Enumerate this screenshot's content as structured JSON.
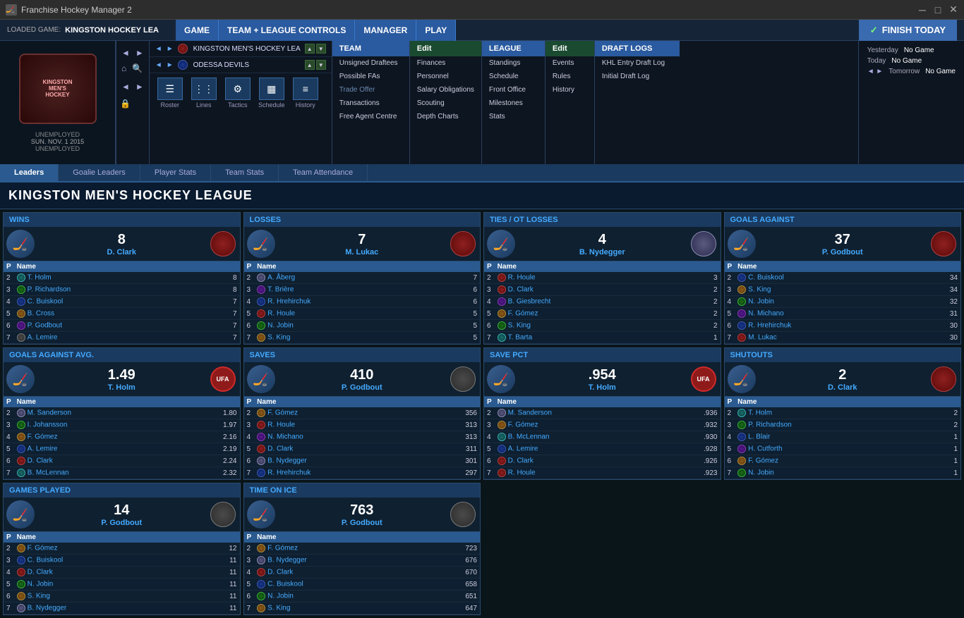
{
  "app": {
    "title": "Franchise Hockey Manager 2",
    "loaded_game_label": "LOADED GAME:",
    "loaded_game": "KINGSTON HOCKEY LEA",
    "status": "UNEMPLOYED",
    "date": "SUN. NOV. 1 2015",
    "status2": "UNEMPLOYED"
  },
  "nav": {
    "game_label": "GAME",
    "team_league_label": "TEAM + LEAGUE CONTROLS",
    "manager_label": "MANAGER",
    "play_label": "PLAY",
    "finish_label": "FINISH TODAY",
    "team_menu": {
      "title": "TEAM",
      "items": [
        "Unsigned Draftees",
        "Possible FAs",
        "Trade Offer",
        "Transactions",
        "Free Agent Centre"
      ]
    },
    "edit_team": {
      "title": "Edit",
      "items": [
        "Finances",
        "Personnel",
        "Salary Obligations",
        "Scouting",
        "Depth Charts"
      ]
    },
    "league_menu": {
      "title": "LEAGUE",
      "items": [
        "Standings",
        "Schedule",
        "Front Office",
        "Milestones",
        "Stats"
      ]
    },
    "edit_league": {
      "title": "Edit",
      "items": [
        "Events",
        "Rules",
        "History"
      ]
    },
    "draft_logs": {
      "title": "DRAFT LOGS",
      "items": [
        "KHL Entry Draft Log",
        "Initial Draft Log"
      ]
    },
    "icons": [
      {
        "label": "Roster",
        "icon": "☰"
      },
      {
        "label": "Lines",
        "icon": "⋮⋮"
      },
      {
        "label": "Tactics",
        "icon": "⚙"
      },
      {
        "label": "Schedule",
        "icon": "▦"
      },
      {
        "label": "History",
        "icon": "≡"
      }
    ],
    "teams": [
      {
        "name": "KINGSTON MEN'S HOCKEY LEA"
      },
      {
        "name": "ODESSA DEVILS"
      }
    ],
    "schedule": {
      "yesterday": "Yesterday",
      "yesterday_val": "No Game",
      "today": "Today",
      "today_val": "No Game",
      "tomorrow": "Tomorrow",
      "tomorrow_val": "No Game"
    }
  },
  "tabs": [
    {
      "id": "leaders",
      "label": "Leaders",
      "active": true
    },
    {
      "id": "goalie-leaders",
      "label": "Goalie Leaders",
      "active": false
    },
    {
      "id": "player-stats",
      "label": "Player Stats",
      "active": false
    },
    {
      "id": "team-stats",
      "label": "Team Stats",
      "active": false
    },
    {
      "id": "team-attendance",
      "label": "Team Attendance",
      "active": false
    }
  ],
  "page_title": "KINGSTON MEN'S HOCKEY LEAGUE",
  "stat_cards": [
    {
      "id": "wins",
      "title": "WINS",
      "leader_value": "8",
      "leader_name": "D. Clark",
      "leader_logo_class": "logo-red",
      "leader_avatar": "🏒",
      "rows": [
        {
          "rank": "2",
          "icon_class": "logo-teal",
          "name": "T. Holm",
          "value": "8"
        },
        {
          "rank": "3",
          "icon_class": "logo-green",
          "name": "P. Richardson",
          "value": "8"
        },
        {
          "rank": "4",
          "icon_class": "logo-blue",
          "name": "C. Buiskool",
          "value": "7"
        },
        {
          "rank": "5",
          "icon_class": "logo-orange",
          "name": "B. Cross",
          "value": "7"
        },
        {
          "rank": "6",
          "icon_class": "logo-purple",
          "name": "P. Godbout",
          "value": "7"
        },
        {
          "rank": "7",
          "icon_class": "logo-gray",
          "name": "A. Lemire",
          "value": "7"
        }
      ]
    },
    {
      "id": "losses",
      "title": "LOSSES",
      "leader_value": "7",
      "leader_name": "M. Lukac",
      "leader_logo_class": "logo-red",
      "leader_avatar": "🏒",
      "rows": [
        {
          "rank": "2",
          "icon_class": "logo-white-star",
          "name": "A. Åberg",
          "value": "7"
        },
        {
          "rank": "3",
          "icon_class": "logo-purple",
          "name": "T. Brière",
          "value": "6"
        },
        {
          "rank": "4",
          "icon_class": "logo-blue",
          "name": "R. Hrehirchuk",
          "value": "6"
        },
        {
          "rank": "5",
          "icon_class": "logo-red",
          "name": "R. Houle",
          "value": "5"
        },
        {
          "rank": "6",
          "icon_class": "logo-green",
          "name": "N. Jobin",
          "value": "5"
        },
        {
          "rank": "7",
          "icon_class": "logo-orange",
          "name": "S. King",
          "value": "5"
        }
      ]
    },
    {
      "id": "ties",
      "title": "TIES / OT LOSSES",
      "leader_value": "4",
      "leader_name": "B. Nydegger",
      "leader_logo_class": "logo-white-star",
      "leader_avatar": "🏒",
      "rows": [
        {
          "rank": "2",
          "icon_class": "logo-red",
          "name": "R. Houle",
          "value": "3"
        },
        {
          "rank": "3",
          "icon_class": "logo-red",
          "name": "D. Clark",
          "value": "2"
        },
        {
          "rank": "4",
          "icon_class": "logo-purple",
          "name": "B. Giesbrecht",
          "value": "2"
        },
        {
          "rank": "5",
          "icon_class": "logo-orange",
          "name": "F. Gómez",
          "value": "2"
        },
        {
          "rank": "6",
          "icon_class": "logo-green",
          "name": "S. King",
          "value": "2"
        },
        {
          "rank": "7",
          "icon_class": "logo-teal",
          "name": "T. Barta",
          "value": "1"
        }
      ]
    },
    {
      "id": "goals-against",
      "title": "GOALS AGAINST",
      "leader_value": "37",
      "leader_name": "P. Godbout",
      "leader_logo_class": "logo-red",
      "leader_avatar": "🏒",
      "rows": [
        {
          "rank": "2",
          "icon_class": "logo-blue",
          "name": "C. Buiskool",
          "value": "34"
        },
        {
          "rank": "3",
          "icon_class": "logo-orange",
          "name": "S. King",
          "value": "34"
        },
        {
          "rank": "4",
          "icon_class": "logo-green",
          "name": "N. Jobin",
          "value": "32"
        },
        {
          "rank": "5",
          "icon_class": "logo-purple",
          "name": "N. Michano",
          "value": "31"
        },
        {
          "rank": "6",
          "icon_class": "logo-blue",
          "name": "R. Hrehirchuk",
          "value": "30"
        },
        {
          "rank": "7",
          "icon_class": "logo-red",
          "name": "M. Lukac",
          "value": "30"
        }
      ]
    },
    {
      "id": "goals-against-avg",
      "title": "GOALS AGAINST AVG.",
      "leader_value": "1.49",
      "leader_name": "T. Holm",
      "leader_logo_class": "logo-ufa",
      "leader_avatar": "🏒",
      "rows": [
        {
          "rank": "2",
          "icon_class": "logo-white-star",
          "name": "M. Sanderson",
          "value": "1.80"
        },
        {
          "rank": "3",
          "icon_class": "logo-green",
          "name": "I. Johansson",
          "value": "1.97"
        },
        {
          "rank": "4",
          "icon_class": "logo-orange",
          "name": "F. Gómez",
          "value": "2.16"
        },
        {
          "rank": "5",
          "icon_class": "logo-blue",
          "name": "A. Lemire",
          "value": "2.19"
        },
        {
          "rank": "6",
          "icon_class": "logo-red",
          "name": "D. Clark",
          "value": "2.24"
        },
        {
          "rank": "7",
          "icon_class": "logo-teal",
          "name": "B. McLennan",
          "value": "2.32"
        }
      ]
    },
    {
      "id": "saves",
      "title": "SAVES",
      "leader_value": "410",
      "leader_name": "P. Godbout",
      "leader_logo_class": "logo-gray",
      "leader_avatar": "🏒",
      "rows": [
        {
          "rank": "2",
          "icon_class": "logo-orange",
          "name": "F. Gómez",
          "value": "356"
        },
        {
          "rank": "3",
          "icon_class": "logo-red",
          "name": "R. Houle",
          "value": "313"
        },
        {
          "rank": "4",
          "icon_class": "logo-purple",
          "name": "N. Michano",
          "value": "313"
        },
        {
          "rank": "5",
          "icon_class": "logo-red",
          "name": "D. Clark",
          "value": "311"
        },
        {
          "rank": "6",
          "icon_class": "logo-white-star",
          "name": "B. Nydegger",
          "value": "301"
        },
        {
          "rank": "7",
          "icon_class": "logo-blue",
          "name": "R. Hrehirchuk",
          "value": "297"
        }
      ]
    },
    {
      "id": "save-pct",
      "title": "SAVE PCT",
      "leader_value": ".954",
      "leader_name": "T. Holm",
      "leader_logo_class": "logo-ufa",
      "leader_avatar": "🏒",
      "rows": [
        {
          "rank": "2",
          "icon_class": "logo-white-star",
          "name": "M. Sanderson",
          "value": ".936"
        },
        {
          "rank": "3",
          "icon_class": "logo-orange",
          "name": "F. Gómez",
          "value": ".932"
        },
        {
          "rank": "4",
          "icon_class": "logo-teal",
          "name": "B. McLennan",
          "value": ".930"
        },
        {
          "rank": "5",
          "icon_class": "logo-blue",
          "name": "A. Lemire",
          "value": ".928"
        },
        {
          "rank": "6",
          "icon_class": "logo-red",
          "name": "D. Clark",
          "value": ".926"
        },
        {
          "rank": "7",
          "icon_class": "logo-red",
          "name": "R. Houle",
          "value": ".923"
        }
      ]
    },
    {
      "id": "shutouts",
      "title": "SHUTOUTS",
      "leader_value": "2",
      "leader_name": "D. Clark",
      "leader_logo_class": "logo-red",
      "leader_avatar": "🏒",
      "rows": [
        {
          "rank": "2",
          "icon_class": "logo-teal",
          "name": "T. Holm",
          "value": "2"
        },
        {
          "rank": "3",
          "icon_class": "logo-green",
          "name": "P. Richardson",
          "value": "2"
        },
        {
          "rank": "4",
          "icon_class": "logo-blue",
          "name": "L. Blair",
          "value": "1"
        },
        {
          "rank": "5",
          "icon_class": "logo-purple",
          "name": "H. Cutforth",
          "value": "1"
        },
        {
          "rank": "6",
          "icon_class": "logo-orange",
          "name": "F. Gómez",
          "value": "1"
        },
        {
          "rank": "7",
          "icon_class": "logo-green",
          "name": "N. Jobin",
          "value": "1"
        }
      ]
    },
    {
      "id": "games-played",
      "title": "GAMES PLAYED",
      "leader_value": "14",
      "leader_name": "P. Godbout",
      "leader_logo_class": "logo-gray",
      "leader_avatar": "🏒",
      "rows": [
        {
          "rank": "2",
          "icon_class": "logo-orange",
          "name": "F. Gómez",
          "value": "12"
        },
        {
          "rank": "3",
          "icon_class": "logo-blue",
          "name": "C. Buiskool",
          "value": "11"
        },
        {
          "rank": "4",
          "icon_class": "logo-red",
          "name": "D. Clark",
          "value": "11"
        },
        {
          "rank": "5",
          "icon_class": "logo-green",
          "name": "N. Jobin",
          "value": "11"
        },
        {
          "rank": "6",
          "icon_class": "logo-orange",
          "name": "S. King",
          "value": "11"
        },
        {
          "rank": "7",
          "icon_class": "logo-white-star",
          "name": "B. Nydegger",
          "value": "11"
        }
      ]
    },
    {
      "id": "time-on-ice",
      "title": "TIME ON ICE",
      "leader_value": "763",
      "leader_name": "P. Godbout",
      "leader_logo_class": "logo-gray",
      "leader_avatar": "🏒",
      "rows": [
        {
          "rank": "2",
          "icon_class": "logo-orange",
          "name": "F. Gómez",
          "value": "723"
        },
        {
          "rank": "3",
          "icon_class": "logo-white-star",
          "name": "B. Nydegger",
          "value": "676"
        },
        {
          "rank": "4",
          "icon_class": "logo-red",
          "name": "D. Clark",
          "value": "670"
        },
        {
          "rank": "5",
          "icon_class": "logo-blue",
          "name": "C. Buiskool",
          "value": "658"
        },
        {
          "rank": "6",
          "icon_class": "logo-green",
          "name": "N. Jobin",
          "value": "651"
        },
        {
          "rank": "7",
          "icon_class": "logo-orange",
          "name": "S. King",
          "value": "647"
        }
      ]
    }
  ]
}
